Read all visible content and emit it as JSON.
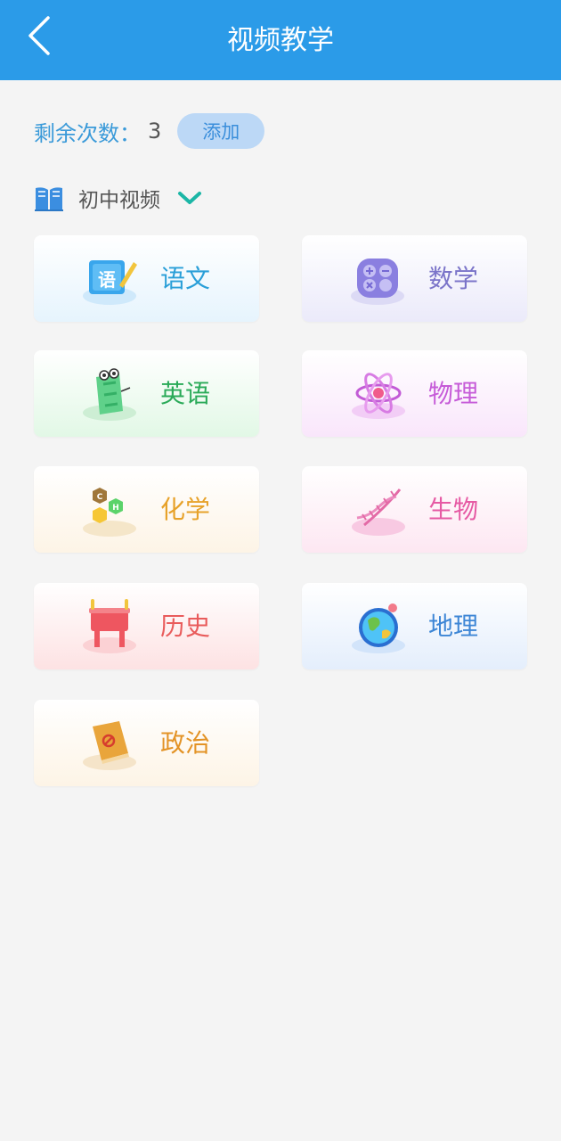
{
  "header": {
    "title": "视频教学"
  },
  "remain": {
    "label": "剩余次数：",
    "count": "3",
    "add_label": "添加"
  },
  "level": {
    "label": "初中视频"
  },
  "subjects": [
    {
      "label": "语文",
      "icon": "chinese-icon",
      "color": "#2a9fd8",
      "bg": "#e6f4fd"
    },
    {
      "label": "数学",
      "icon": "math-icon",
      "color": "#7b74c9",
      "bg": "#ebeafa"
    },
    {
      "label": "英语",
      "icon": "english-icon",
      "color": "#2aaa58",
      "bg": "#e2f8e6"
    },
    {
      "label": "物理",
      "icon": "physics-icon",
      "color": "#c65bd8",
      "bg": "#f9e6fb"
    },
    {
      "label": "化学",
      "icon": "chemistry-icon",
      "color": "#e7a22a",
      "bg": "#fdf4e6"
    },
    {
      "label": "生物",
      "icon": "biology-icon",
      "color": "#e65aa4",
      "bg": "#fde7f2"
    },
    {
      "label": "历史",
      "icon": "history-icon",
      "color": "#e95b5b",
      "bg": "#fde2e3"
    },
    {
      "label": "地理",
      "icon": "geography-icon",
      "color": "#3d86d6",
      "bg": "#e4eefc"
    },
    {
      "label": "政治",
      "icon": "politics-icon",
      "color": "#e39326",
      "bg": "#fdf4e6"
    }
  ]
}
